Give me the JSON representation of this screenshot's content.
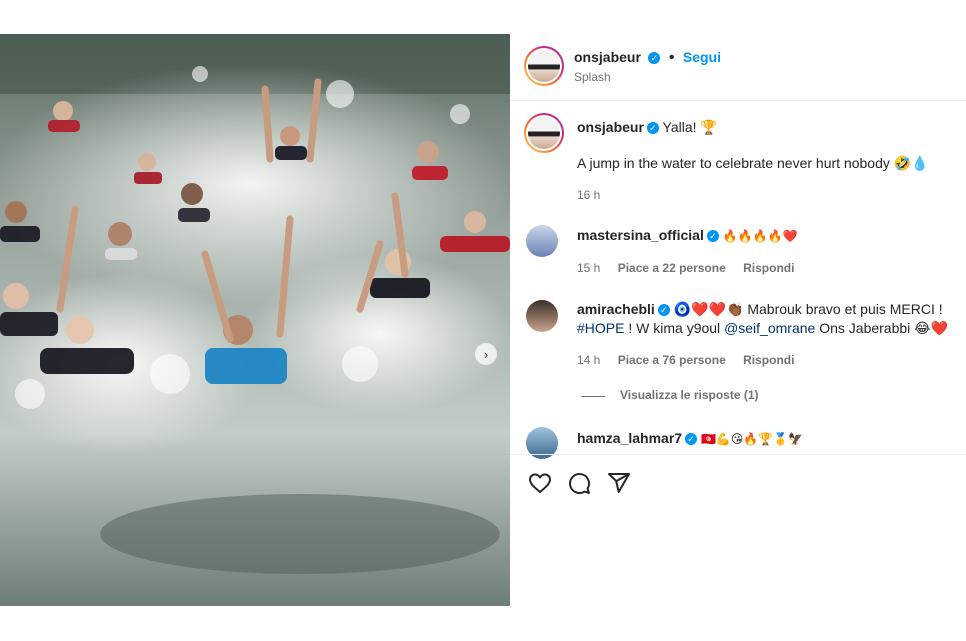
{
  "post": {
    "author": "onsjabeur",
    "follow_label": "Segui",
    "separator": "•",
    "audio": "Splash",
    "caption_title": "Yalla! 🏆",
    "caption_body": "A jump in the water to celebrate never hurt nobody 🤣💧",
    "time": "16 h"
  },
  "comments": [
    {
      "user": "mastersina_official",
      "text": "🔥🔥🔥🔥❤️",
      "time": "15 h",
      "likes": "Piace a 22 persone",
      "reply": "Rispondi"
    },
    {
      "user": "amirachebli",
      "text_line1": "🧿❤️❤️👏🏾 Mabrouk bravo et puis MERCI !",
      "hashtag": "#HOPE",
      "text_mid": " ! W kima y9oul ",
      "mention": "@seif_omrane",
      "text_end": " Ons Jaberabbi 😂❤️",
      "time": "14 h",
      "likes": "Piace a 76 persone",
      "reply": "Rispondi",
      "view_replies": "Visualizza le risposte (1)"
    },
    {
      "user": "hamza_lahmar7",
      "text": "🇹🇳💪😘🔥🏆🥇🦅"
    }
  ],
  "icons": [
    "heart-icon",
    "comment-icon",
    "share-icon",
    "verified-icon",
    "chevron-right-icon"
  ],
  "colors": {
    "accent": "#0095f6",
    "text": "#262626",
    "muted": "#737373",
    "link": "#00376b"
  },
  "carousel": {
    "count": 3,
    "active": 2
  }
}
